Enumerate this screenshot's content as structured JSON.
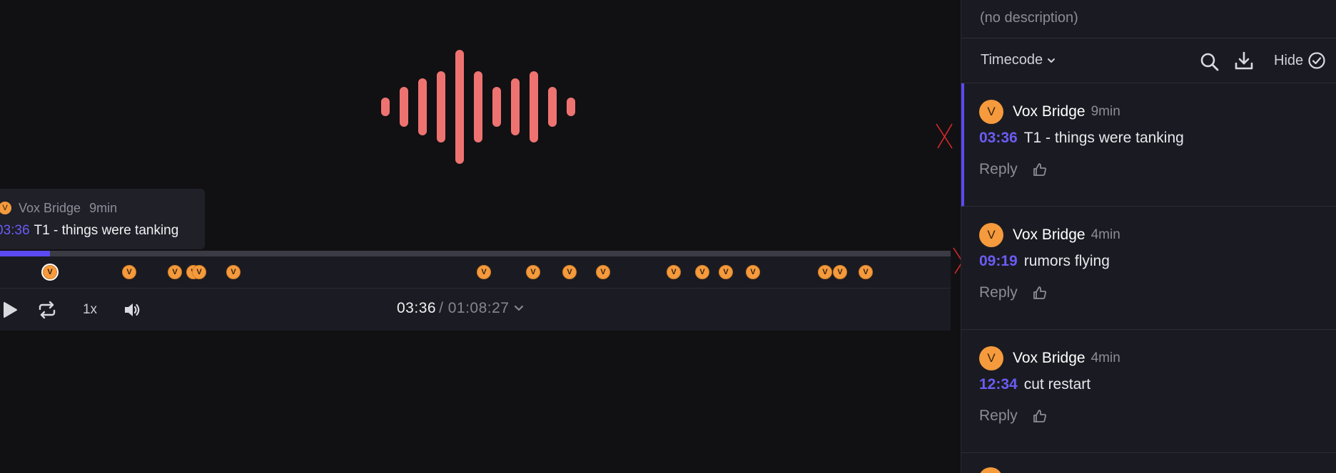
{
  "player": {
    "speed": "1x",
    "current_time": "03:36",
    "duration": "/ 01:08:27",
    "progress_fraction": 0.0526,
    "marker_letter": "V",
    "marker_times": [
      "03:36",
      "09:19",
      "12:34",
      "13:55",
      "14:20",
      "16:48",
      "34:51",
      "38:22",
      "41:00",
      "43:25",
      "48:30",
      "50:35",
      "52:15",
      "54:12",
      "59:23",
      "1:00:30",
      "1:02:20"
    ],
    "hover_tooltip": {
      "author": "Vox Bridge",
      "ago": "9min",
      "timecode": "03:36",
      "text": "T1 - things were tanking"
    }
  },
  "panel": {
    "description": "(no description)",
    "sort_label": "Timecode",
    "hide_label": "Hide",
    "comments": [
      {
        "avatar": "V",
        "author": "Vox Bridge",
        "ago": "9min",
        "timecode": "03:36",
        "text": "T1 - things were tanking",
        "reply": "Reply",
        "selected": true
      },
      {
        "avatar": "V",
        "author": "Vox Bridge",
        "ago": "4min",
        "timecode": "09:19",
        "text": "rumors flying",
        "reply": "Reply",
        "selected": false
      },
      {
        "avatar": "V",
        "author": "Vox Bridge",
        "ago": "4min",
        "timecode": "12:34",
        "text": "cut restart",
        "reply": "Reply",
        "selected": false
      }
    ]
  },
  "colors": {
    "accent": "#5b4af2",
    "marker": "#f59a3d",
    "waveform": "#ee7370",
    "panel_bg": "#1a1b22"
  },
  "icons": {
    "play": "play-icon",
    "loop": "loop-icon",
    "volume": "volume-icon",
    "search": "search-icon",
    "download": "download-icon",
    "hide_check": "check-circle-icon",
    "like": "thumbs-up-icon",
    "chevron": "chevron-down-icon"
  }
}
